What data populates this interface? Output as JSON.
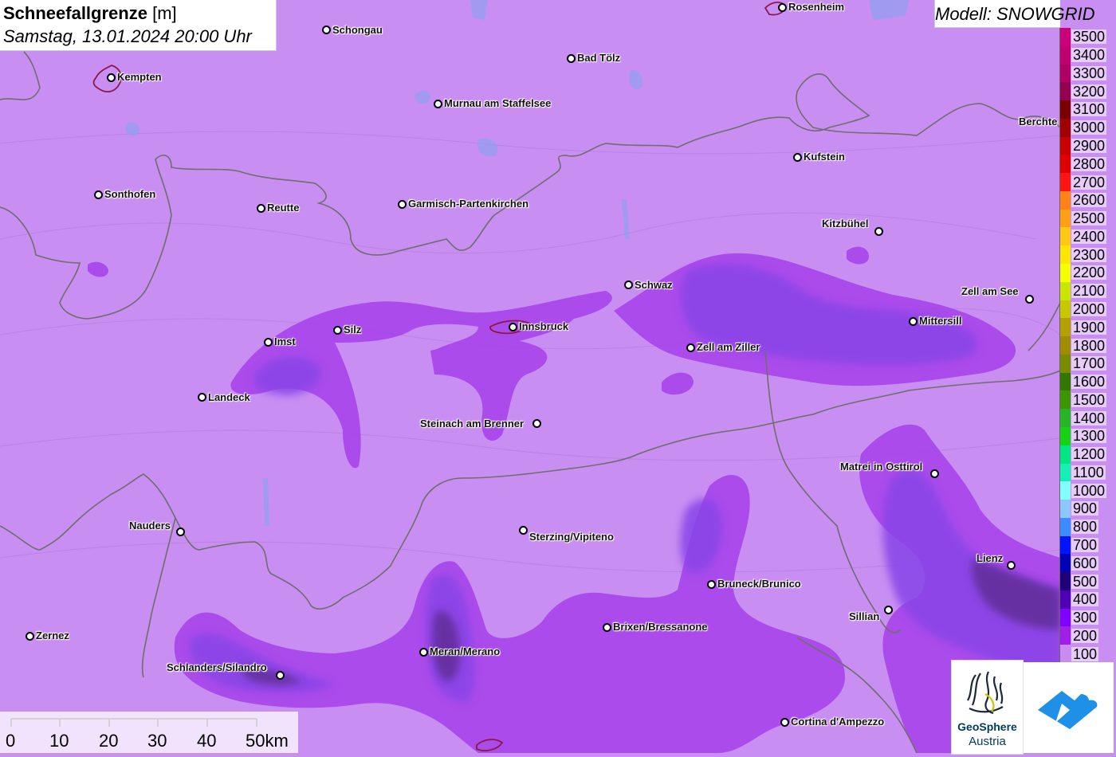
{
  "title": {
    "main": "Schneefallgrenze",
    "unit": "[m]",
    "datetime": "Samstag, 13.01.2024 20:00 Uhr"
  },
  "model": "Modell: SNOWGRID",
  "legend": [
    {
      "value": "3500",
      "color": "#cc007a"
    },
    {
      "value": "3400",
      "color": "#c0006e"
    },
    {
      "value": "3300",
      "color": "#b00064"
    },
    {
      "value": "3200",
      "color": "#960050"
    },
    {
      "value": "3100",
      "color": "#7a0000"
    },
    {
      "value": "3000",
      "color": "#a00000"
    },
    {
      "value": "2900",
      "color": "#c80000"
    },
    {
      "value": "2800",
      "color": "#e00000"
    },
    {
      "value": "2700",
      "color": "#ff1414"
    },
    {
      "value": "2600",
      "color": "#ff8214"
    },
    {
      "value": "2500",
      "color": "#ffa014"
    },
    {
      "value": "2400",
      "color": "#ffc814"
    },
    {
      "value": "2300",
      "color": "#ffe600"
    },
    {
      "value": "2200",
      "color": "#f5ff00"
    },
    {
      "value": "2100",
      "color": "#c8e600"
    },
    {
      "value": "2000",
      "color": "#c8c800"
    },
    {
      "value": "1900",
      "color": "#b4a000"
    },
    {
      "value": "1800",
      "color": "#a08c00"
    },
    {
      "value": "1700",
      "color": "#788c00"
    },
    {
      "value": "1600",
      "color": "#327800"
    },
    {
      "value": "1500",
      "color": "#3c9600"
    },
    {
      "value": "1400",
      "color": "#28b428"
    },
    {
      "value": "1300",
      "color": "#14d214"
    },
    {
      "value": "1200",
      "color": "#00e682"
    },
    {
      "value": "1100",
      "color": "#14f0b4"
    },
    {
      "value": "1000",
      "color": "#82ffff"
    },
    {
      "value": "900",
      "color": "#8cc8ff"
    },
    {
      "value": "800",
      "color": "#3c8cff"
    },
    {
      "value": "700",
      "color": "#0014ff"
    },
    {
      "value": "600",
      "color": "#0000b4"
    },
    {
      "value": "500",
      "color": "#1e0078"
    },
    {
      "value": "400",
      "color": "#5000b4"
    },
    {
      "value": "300",
      "color": "#8200ff"
    },
    {
      "value": "200",
      "color": "#a01ee6"
    },
    {
      "value": "100",
      "color": "#c88cf0"
    }
  ],
  "cities": [
    {
      "name": "Rosenheim"
    },
    {
      "name": "Schongau"
    },
    {
      "name": "Bad Tölz"
    },
    {
      "name": "Kempten"
    },
    {
      "name": "Murnau am Staffelsee"
    },
    {
      "name": "Berchte"
    },
    {
      "name": "Kufstein"
    },
    {
      "name": "Sonthofen"
    },
    {
      "name": "Reutte"
    },
    {
      "name": "Garmisch-Partenkirchen"
    },
    {
      "name": "Kitzbühel"
    },
    {
      "name": "Schwaz"
    },
    {
      "name": "Zell am See"
    },
    {
      "name": "Mittersill"
    },
    {
      "name": "Silz"
    },
    {
      "name": "Innsbruck"
    },
    {
      "name": "Imst"
    },
    {
      "name": "Zell am Ziller"
    },
    {
      "name": "Landeck"
    },
    {
      "name": "Steinach am Brenner"
    },
    {
      "name": "Matrei in Osttirol"
    },
    {
      "name": "Nauders"
    },
    {
      "name": "Sterzing/Vipiteno"
    },
    {
      "name": "Lienz"
    },
    {
      "name": "Bruneck/Brunico"
    },
    {
      "name": "Sillian"
    },
    {
      "name": "Brixen/Bressanone"
    },
    {
      "name": "Zernez"
    },
    {
      "name": "Meran/Merano"
    },
    {
      "name": "Schlanders/Silandro"
    },
    {
      "name": "Cortina d'Ampezzo"
    }
  ],
  "scale": {
    "labels": [
      "0",
      "10",
      "20",
      "30",
      "40",
      "50km"
    ]
  },
  "logos": {
    "geosphere_line1": "GeoSphere",
    "geosphere_line2": "Austria"
  },
  "colors": {
    "base_field": "#c98ef2",
    "band_200": "#a63be6",
    "band_300": "#8a3de8",
    "band_400": "#6a2aa8",
    "border": "#6e6e6e"
  }
}
